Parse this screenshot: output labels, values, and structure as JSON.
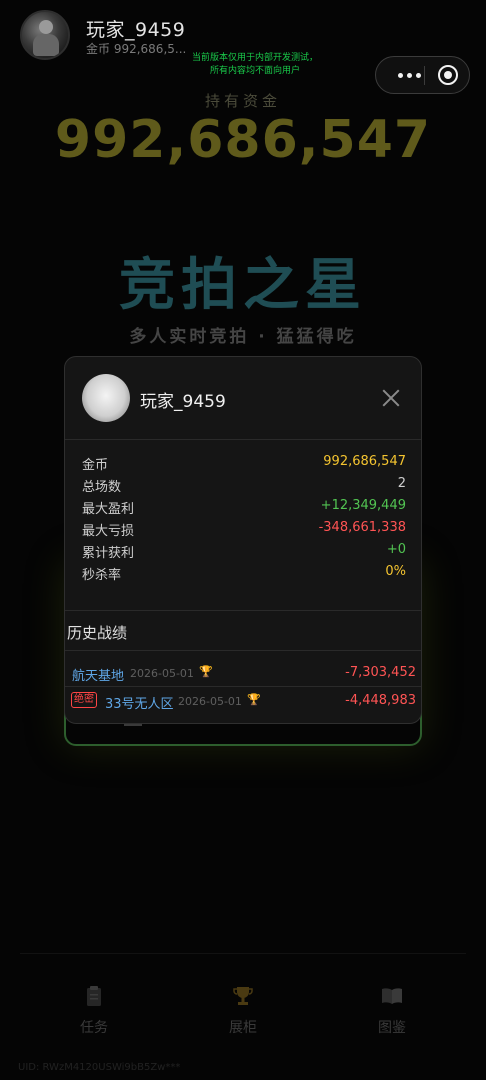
{
  "header": {
    "player_name": "玩家_9459",
    "coin_line": "金币 992,686,5...",
    "dev_notice_line1": "当前版本仅用于内部开发测试，",
    "dev_notice_line2": "所有内容均不面向用户"
  },
  "capsule": {
    "more_icon": "more-dots-icon",
    "close_icon": "target-circle-icon"
  },
  "funds": {
    "label": "持有资金",
    "value": "992,686,547"
  },
  "game": {
    "title": "竞拍之星",
    "subtitle": "多人实时竞拍 · 猛猛得吃"
  },
  "popup": {
    "name": "玩家_9459",
    "stats": [
      {
        "label": "金币",
        "value": "992,686,547",
        "color": "#f4c430"
      },
      {
        "label": "总场数",
        "value": "2",
        "color": "#cfcfcf"
      },
      {
        "label": "最大盈利",
        "value": "+12,349,449",
        "color": "#52c452"
      },
      {
        "label": "最大亏损",
        "value": "-348,661,338",
        "color": "#ff5454"
      },
      {
        "label": "累计获利",
        "value": "+0",
        "color": "#52c452"
      },
      {
        "label": "秒杀率",
        "value": "0%",
        "color": "#f4c430"
      }
    ],
    "history_title": "历史战绩",
    "history": [
      {
        "map": "航天基地",
        "tag": "",
        "date": "2026-05-01",
        "amount": "-7,303,452"
      },
      {
        "map": "33号无人区",
        "tag": "绝密",
        "date": "2026-05-01",
        "amount": "-4,448,983"
      }
    ]
  },
  "nav": [
    {
      "label": "任务",
      "icon": "clipboard-icon"
    },
    {
      "label": "展柜",
      "icon": "trophy-icon"
    },
    {
      "label": "图鉴",
      "icon": "book-icon"
    }
  ],
  "uid_line": "UID: RWzM4120USWi9bB5Zw***"
}
